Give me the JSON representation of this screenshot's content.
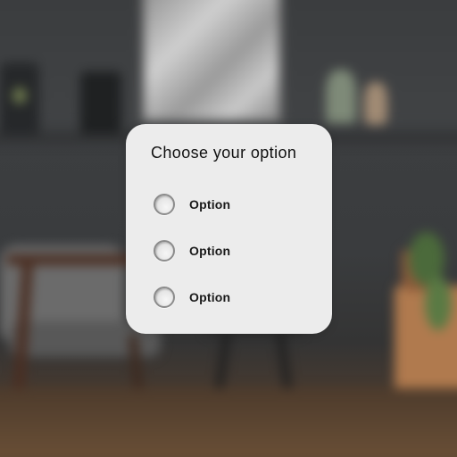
{
  "dialog": {
    "title": "Choose your option",
    "options": [
      {
        "label": "Option",
        "selected": false
      },
      {
        "label": "Option",
        "selected": false
      },
      {
        "label": "Option",
        "selected": false
      }
    ]
  },
  "colors": {
    "card_background": "#ececec",
    "title_text": "#111111",
    "radio_border": "#8c8c8c"
  }
}
